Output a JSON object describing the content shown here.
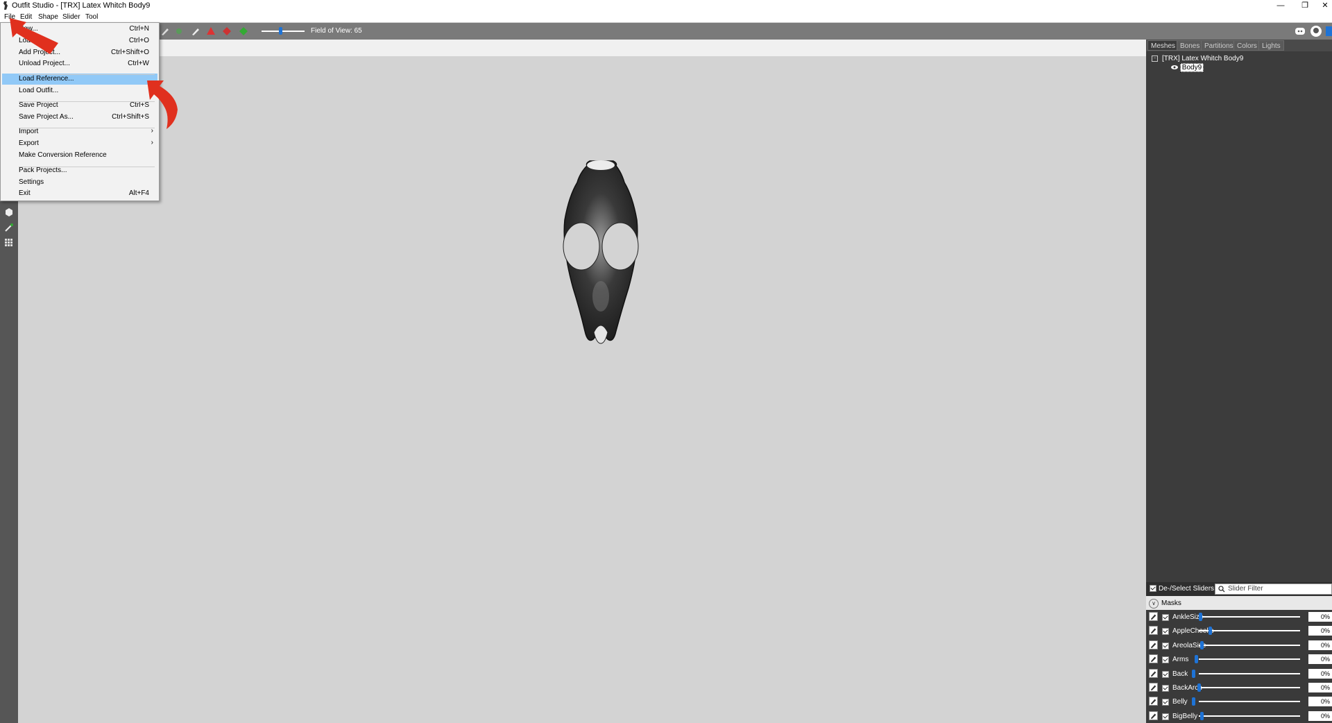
{
  "window": {
    "title": "Outfit Studio - [TRX] Latex Whitch Body9",
    "minimize": "—",
    "restore": "❐",
    "close": "✕"
  },
  "menubar": {
    "items": [
      "File",
      "Edit",
      "Shape",
      "Slider",
      "Tool"
    ]
  },
  "file_menu": {
    "items": [
      {
        "label": "New...",
        "shortcut": "Ctrl+N"
      },
      {
        "label": "Load ...",
        "shortcut": "Ctrl+O"
      },
      {
        "label": "Add Project...",
        "shortcut": "Ctrl+Shift+O"
      },
      {
        "label": "Unload Project...",
        "shortcut": "Ctrl+W"
      },
      {
        "label": "Load Reference...",
        "shortcut": ""
      },
      {
        "label": "Load Outfit...",
        "shortcut": ""
      },
      {
        "label": "Save Project",
        "shortcut": "Ctrl+S"
      },
      {
        "label": "Save Project As...",
        "shortcut": "Ctrl+Shift+S"
      },
      {
        "label": "Import",
        "shortcut": ""
      },
      {
        "label": "Export",
        "shortcut": ""
      },
      {
        "label": "Make Conversion Reference",
        "shortcut": ""
      },
      {
        "label": "Pack Projects...",
        "shortcut": ""
      },
      {
        "label": "Settings",
        "shortcut": ""
      },
      {
        "label": "Exit",
        "shortcut": "Alt+F4"
      }
    ],
    "highlighted": "Load Reference...",
    "submenu_arrow": "›"
  },
  "toolbar": {
    "field_of_view_label": "Field of View: 65",
    "field_of_view": 65
  },
  "right_panel": {
    "tabs": [
      "Meshes",
      "Bones",
      "Partitions",
      "Colors",
      "Lights"
    ],
    "active_tab": "Meshes",
    "tree": {
      "root": "[TRX] Latex Whitch Body9",
      "expander": "−",
      "child": "Body9"
    },
    "deselect_label": "De-/Select Sliders",
    "slider_filter_placeholder": "Slider Filter",
    "masks_label": "Masks",
    "masks_chevron": "∨",
    "sliders": [
      {
        "name": "AnkleSize",
        "value": "0%",
        "fill": 0
      },
      {
        "name": "AppleCheeks",
        "value": "0%",
        "fill": 0
      },
      {
        "name": "AreolaSize",
        "value": "0%",
        "fill": 0
      },
      {
        "name": "Arms",
        "value": "0%",
        "fill": 0
      },
      {
        "name": "Back",
        "value": "0%",
        "fill": 0
      },
      {
        "name": "BackArch",
        "value": "0%",
        "fill": 0
      },
      {
        "name": "Belly",
        "value": "0%",
        "fill": 0
      },
      {
        "name": "BigBelly",
        "value": "0%",
        "fill": 0
      }
    ]
  },
  "colors": {
    "menu_highlight": "#91c9f7",
    "toolbar_bg": "#7a7a7a",
    "viewport_bg": "#d3d3d3",
    "panel_bg": "#3a3a3a",
    "slider_accent": "#1e73d6",
    "arrow_red": "#e0301e"
  }
}
